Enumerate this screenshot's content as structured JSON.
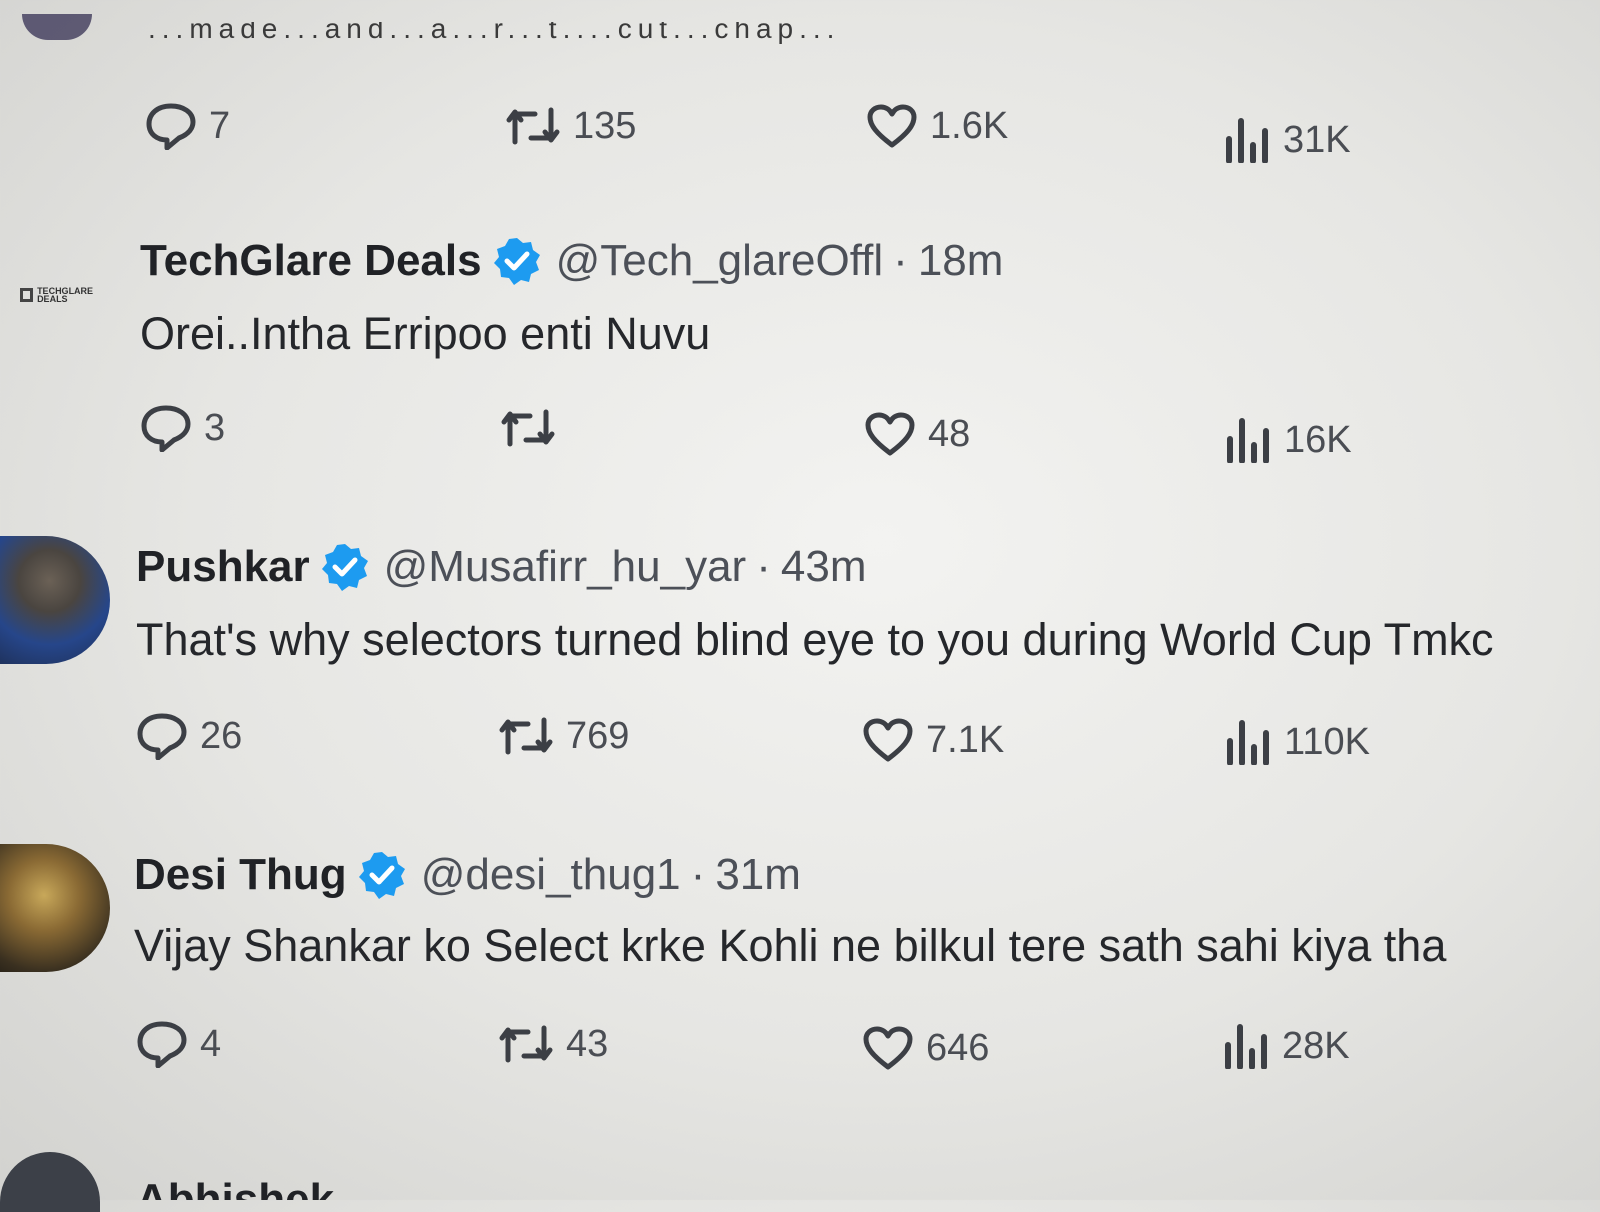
{
  "top_partial": {
    "text": "...made...and...a...r...t....cut...chap...",
    "stats": {
      "replies": "7",
      "retweets": "135",
      "likes": "1.6K",
      "views": "31K"
    }
  },
  "tweets": [
    {
      "name": "TechGlare Deals",
      "handle": "@Tech_glareOffl",
      "separator": "·",
      "time": "18m",
      "text": "Orei..Intha Erripoo enti Nuvu",
      "logo_text": "TECHGLARE DEALS",
      "stats": {
        "replies": "3",
        "retweets": "",
        "likes": "48",
        "views": "16K"
      }
    },
    {
      "name": "Pushkar",
      "handle": "@Musafirr_hu_yar",
      "separator": "·",
      "time": "43m",
      "text": "That's why selectors turned blind eye to you during World Cup Tmkc",
      "stats": {
        "replies": "26",
        "retweets": "769",
        "likes": "7.1K",
        "views": "110K"
      }
    },
    {
      "name": "Desi Thug",
      "handle": "@desi_thug1",
      "separator": "·",
      "time": "31m",
      "text": "Vijay Shankar ko Select krke Kohli ne bilkul tere sath sahi kiya tha",
      "stats": {
        "replies": "4",
        "retweets": "43",
        "likes": "646",
        "views": "28K"
      }
    }
  ],
  "bottom_partial": {
    "name": "Abhishek"
  },
  "colors": {
    "verified": "#1d9bf0",
    "text": "#25272b",
    "muted": "#4c5058"
  },
  "icons": [
    "reply-icon",
    "retweet-icon",
    "like-icon",
    "views-icon",
    "verified-badge-icon"
  ]
}
